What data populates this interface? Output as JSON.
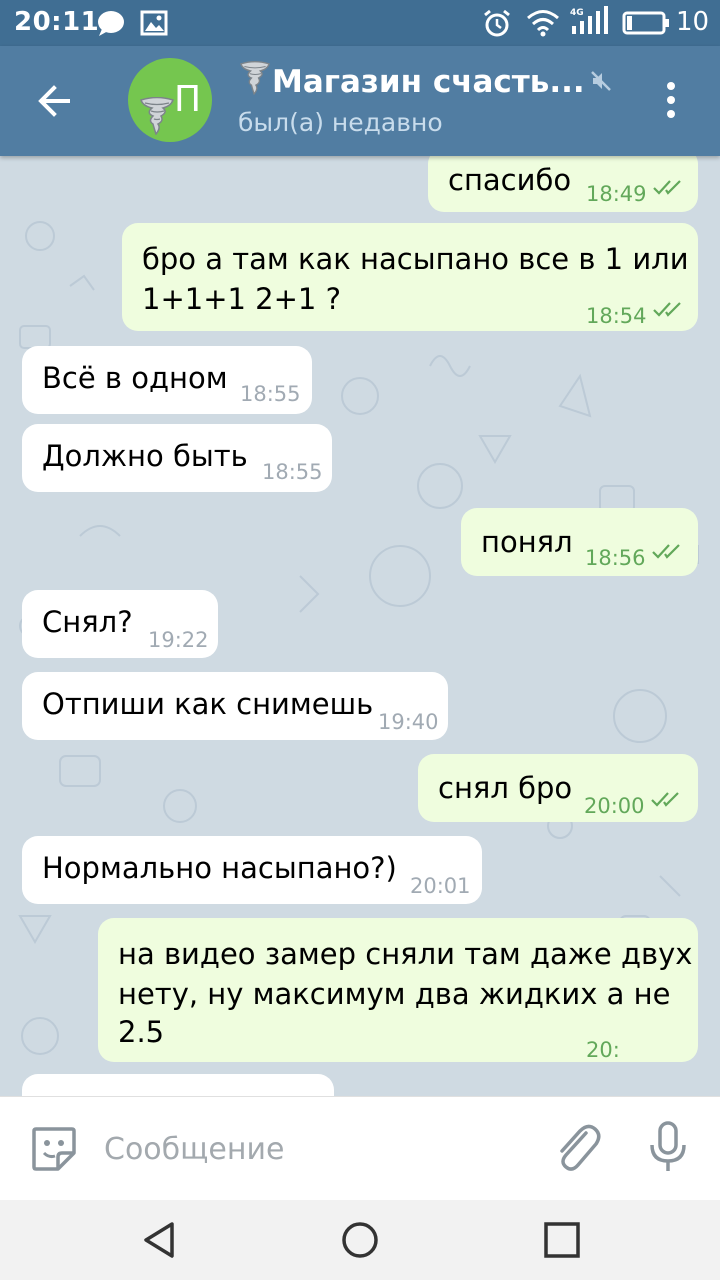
{
  "status_bar": {
    "time": "20:11",
    "network": "4G",
    "battery": "10"
  },
  "header": {
    "avatar_initial": "П",
    "title": "Магазин счасть...",
    "status": "был(а) недавно"
  },
  "messages": [
    {
      "dir": "out",
      "text": "спасибо",
      "time": "18:49"
    },
    {
      "dir": "out",
      "text": "бро а там как насыпано все в 1 или",
      "text2": "1+1+1 2+1 ?",
      "time": "18:54"
    },
    {
      "dir": "in",
      "text": "Всё в одном",
      "time": "18:55"
    },
    {
      "dir": "in",
      "text": "Должно быть",
      "time": "18:55"
    },
    {
      "dir": "out",
      "text": "понял",
      "time": "18:56"
    },
    {
      "dir": "in",
      "text": "Снял?",
      "time": "19:22"
    },
    {
      "dir": "in",
      "text": "Отпиши как снимешь",
      "time": "19:40"
    },
    {
      "dir": "out",
      "text": "снял бро",
      "time": "20:00"
    },
    {
      "dir": "in",
      "text": "Нормально насыпано?)",
      "time": "20:01"
    },
    {
      "dir": "out",
      "text": "на видео замер сняли там даже двух",
      "text2": "нету, ну максимум два жидких а не",
      "text3": "2.5",
      "time": "20:"
    }
  ],
  "composer": {
    "placeholder": "Сообщение"
  },
  "colors": {
    "header": "#517da2",
    "status_bar": "#406e93",
    "chat_bg": "#cfdae2",
    "bubble_in": "#ffffff",
    "bubble_out": "#effdde",
    "time_out": "#62a85a",
    "avatar": "#75c64f"
  }
}
